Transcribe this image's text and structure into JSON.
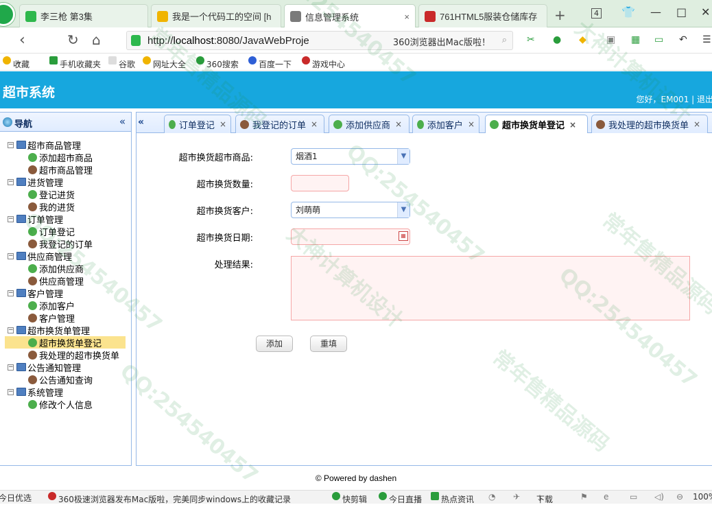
{
  "browser": {
    "tabs": [
      {
        "title": "李三枪 第3集",
        "color": "#2fb84d"
      },
      {
        "title": "我是一个代码工的空间 [h",
        "color": "#f0b400"
      },
      {
        "title": "信息管理系统",
        "color": "#7a7a7a"
      },
      {
        "title": "761HTML5服装仓储库存",
        "color": "#c92a2a"
      }
    ],
    "new_tab": "+",
    "tab_count": "4",
    "url_prefix": "http://",
    "url_host": "localhost",
    "url_rest": ":8080/JavaWebProje",
    "search_text": "360浏览器出Mac版啦！",
    "bookmarks": [
      "收藏",
      "手机收藏夹",
      "谷歌",
      "网址大全",
      "360搜索",
      "百度一下",
      "游戏中心"
    ]
  },
  "app": {
    "title": "超市系统",
    "user_greeting": "您好，EM001 | 退出"
  },
  "sidebar": {
    "title": "导航",
    "collapse": "«",
    "groups": [
      {
        "label": "超市商品管理",
        "items": [
          "添加超市商品",
          "超市商品管理"
        ]
      },
      {
        "label": "进货管理",
        "items": [
          "登记进货",
          "我的进货"
        ]
      },
      {
        "label": "订单管理",
        "items": [
          "订单登记",
          "我登记的订单"
        ]
      },
      {
        "label": "供应商管理",
        "items": [
          "添加供应商",
          "供应商管理"
        ]
      },
      {
        "label": "客户管理",
        "items": [
          "添加客户",
          "客户管理"
        ]
      },
      {
        "label": "超市换货单管理",
        "items": [
          "超市换货单登记",
          "我处理的超市换货单"
        ]
      },
      {
        "label": "公告通知管理",
        "items": [
          "公告通知查询"
        ]
      },
      {
        "label": "系统管理",
        "items": [
          "修改个人信息"
        ]
      }
    ],
    "selected": "超市换货单登记"
  },
  "content_tabs": [
    "订单登记",
    "我登记的订单",
    "添加供应商",
    "添加客户",
    "超市换货单登记",
    "我处理的超市换货单"
  ],
  "content_tabs_scroll": "«",
  "active_tab": "超市换货单登记",
  "form": {
    "product_label": "超市换货超市商品:",
    "product_value": "烟酒1",
    "qty_label": "超市换货数量:",
    "qty_value": "",
    "customer_label": "超市换货客户:",
    "customer_value": "刘萌萌",
    "date_label": "超市换货日期:",
    "date_value": "",
    "result_label": "处理结果:",
    "result_value": "",
    "submit_label": "添加",
    "reset_label": "重填"
  },
  "footer": "© Powered by dashen",
  "statusbar": {
    "left": "今日优选",
    "news": "360极速浏览器发布Mac版啦，完美同步windows上的收藏记录",
    "items": [
      "快剪辑",
      "今日直播",
      "热点资讯",
      "下载",
      "100%"
    ]
  },
  "watermarks": [
    "QQ:254540457",
    "大神计算机设计",
    "常年售精品源码"
  ]
}
